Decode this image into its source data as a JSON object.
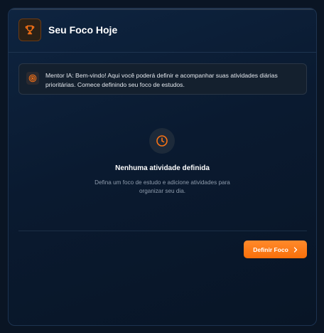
{
  "header": {
    "title": "Seu Foco Hoje",
    "icon": "trophy-icon",
    "accent": "#f97316"
  },
  "mentor": {
    "icon": "target-icon",
    "message": "Mentor IA: Bem-vindo! Aqui você poderá definir e acompanhar suas atividades diárias prioritárias. Comece definindo seu foco de estudos."
  },
  "empty_state": {
    "icon": "clock-icon",
    "title": "Nenhuma atividade definida",
    "description": "Defina um foco de estudo e adicione atividades para organizar seu dia."
  },
  "actions": {
    "define_label": "Definir Foco",
    "define_icon": "chevron-right-icon"
  }
}
